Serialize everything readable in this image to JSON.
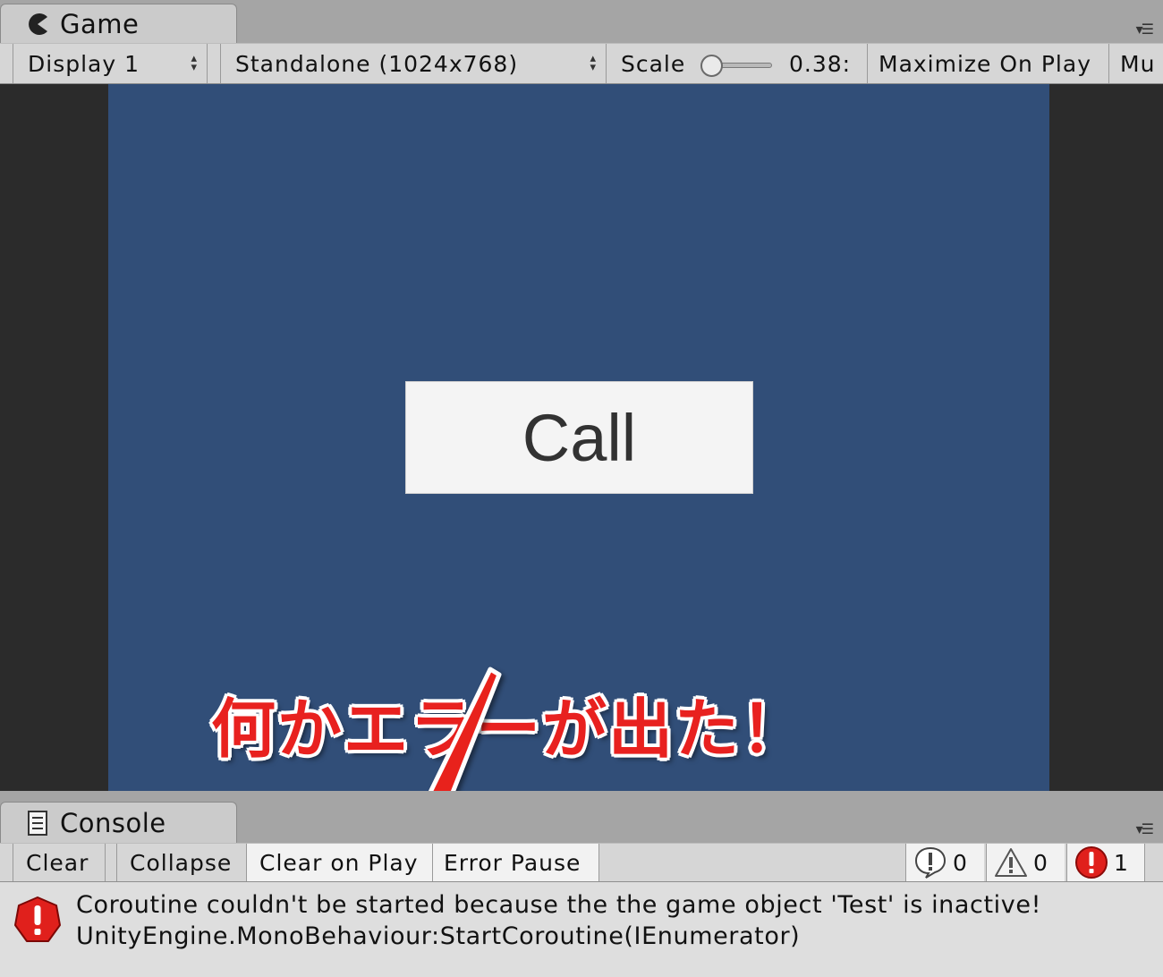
{
  "game_panel": {
    "tab_label": "Game",
    "tab_icon": "pacman-icon",
    "display_select": "Display 1",
    "resolution_select": "Standalone (1024x768)",
    "scale_label": "Scale",
    "scale_value": "0.38:",
    "maximize_label": "Maximize On Play",
    "mute_label": "Mu",
    "scale_slider_level": 0.0
  },
  "game_view": {
    "button_label": "Call",
    "annotation_text": "何かエラーが出た！",
    "colors": {
      "background": "#314e78",
      "annotation": "#e8211f",
      "letterbox": "#2b2b2b"
    }
  },
  "console_panel": {
    "tab_label": "Console",
    "tab_icon": "console-log-icon",
    "toolbar": {
      "clear": "Clear",
      "collapse": "Collapse",
      "clear_on_play": "Clear on Play",
      "error_pause": "Error Pause"
    },
    "counts": {
      "info": "0",
      "warning": "0",
      "error": "1"
    },
    "log": {
      "message": "Coroutine couldn't be started because the the game object 'Test' is inactive!",
      "trace": "UnityEngine.MonoBehaviour:StartCoroutine(IEnumerator)"
    }
  }
}
